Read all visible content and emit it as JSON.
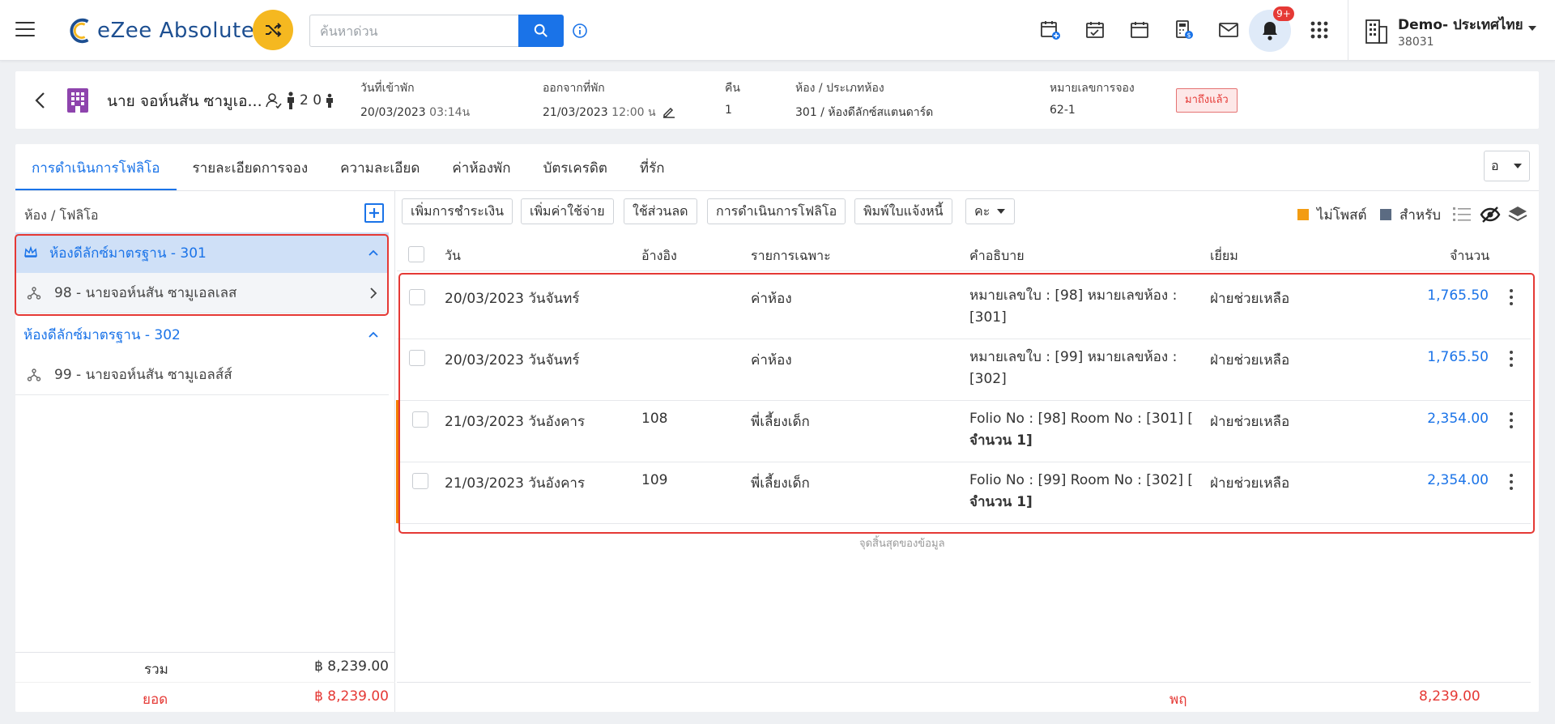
{
  "app": {
    "logo_text": "eZee Absolute"
  },
  "search": {
    "placeholder": "ค้นหาด่วน"
  },
  "notifications": {
    "badge": "9+"
  },
  "org": {
    "name": "Demo- ประเทศไทย",
    "id": "38031"
  },
  "reservation": {
    "guest_name": "นาย จอห์นสัน ซามูเอ...",
    "pax": "2 0",
    "arrival_label": "วันที่เข้าพัก",
    "arrival_date": "20/03/2023",
    "arrival_time": "03:14น",
    "departure_label": "ออกจากที่พัก",
    "departure_date": "21/03/2023",
    "departure_time": "12:00 น",
    "nights_label": "คืน",
    "nights": "1",
    "room_label": "ห้อง / ประเภทห้อง",
    "room_value": "301 / ห้องดีลักซ์สแตนดาร์ด",
    "res_no_label": "หมายเลขการจอง",
    "res_no": "62-1",
    "status": "มาถึงแล้ว",
    "status_color": "#e53935"
  },
  "tabs": [
    {
      "label": "การดำเนินการโฟลิโอ"
    },
    {
      "label": "รายละเอียดการจอง"
    },
    {
      "label": "ความละเอียด"
    },
    {
      "label": "ค่าห้องพัก"
    },
    {
      "label": "บัตรเครดิต"
    },
    {
      "label": "ที่รัก"
    }
  ],
  "view_select": {
    "value": "อ"
  },
  "left_panel": {
    "title": "ห้อง / โฟลิโอ",
    "rooms": [
      {
        "label": "ห้องดีลักซ์มาตรฐาน - 301",
        "folio": "98 - นายจอห์นสัน ซามูเอลเลส"
      },
      {
        "label": "ห้องดีลักซ์มาตรฐาน - 302",
        "folio": "99 - นายจอห์นสัน ซามูเอลส์ส์"
      }
    ],
    "total_label": "รวม",
    "total_value": "฿ 8,239.00",
    "balance_label": "ยอด",
    "balance_value": "฿ 8,239.00"
  },
  "toolbar": {
    "add_payment": "เพิ่มการชำระเงิน",
    "add_charge": "เพิ่มค่าใช้จ่าย",
    "apply_discount": "ใช้ส่วนลด",
    "folio_ops": "การดำเนินการโฟลิโอ",
    "print_invoice": "พิมพ์ใบแจ้งหนี้",
    "more": "คะ",
    "legend_unposted": "ไม่โพสต์",
    "legend_for": "สำหรับ",
    "legend_unposted_color": "#f39c12",
    "legend_for_color": "#5b6b82"
  },
  "grid": {
    "headers": {
      "date": "วัน",
      "ref": "อ้างอิง",
      "particular": "รายการเฉพาะ",
      "description": "คำอธิบาย",
      "user": "เยี่ยม",
      "amount": "จำนวน"
    },
    "rows": [
      {
        "date": "20/03/2023 วันจันทร์",
        "ref": "",
        "particular": "ค่าห้อง",
        "desc_line1": "หมายเลขใบ : [98] หมายเลขห้อง :",
        "desc_line2": "[301]",
        "user": "ฝ่ายช่วยเหลือ",
        "amount": "1,765.50"
      },
      {
        "date": "20/03/2023 วันจันทร์",
        "ref": "",
        "particular": "ค่าห้อง",
        "desc_line1": "หมายเลขใบ : [99] หมายเลขห้อง :",
        "desc_line2": "[302]",
        "user": "ฝ่ายช่วยเหลือ",
        "amount": "1,765.50"
      },
      {
        "date": "21/03/2023 วันอังคาร",
        "ref": "108",
        "particular": "พี่เลี้ยงเด็ก",
        "desc_line1": "Folio No : [98] Room No : [301] [",
        "desc_line2": "จำนวน 1]",
        "user": "ฝ่ายช่วยเหลือ",
        "amount": "2,354.00"
      },
      {
        "date": "21/03/2023 วันอังคาร",
        "ref": "109",
        "particular": "พี่เลี้ยงเด็ก",
        "desc_line1": "Folio No : [99] Room No : [302] [",
        "desc_line2": "จำนวน 1]",
        "user": "ฝ่ายช่วยเหลือ",
        "amount": "2,354.00"
      }
    ],
    "end_text": "จุดสิ้นสุดของข้อมูล",
    "footer_label": "พฤ",
    "footer_value": "8,239.00"
  }
}
